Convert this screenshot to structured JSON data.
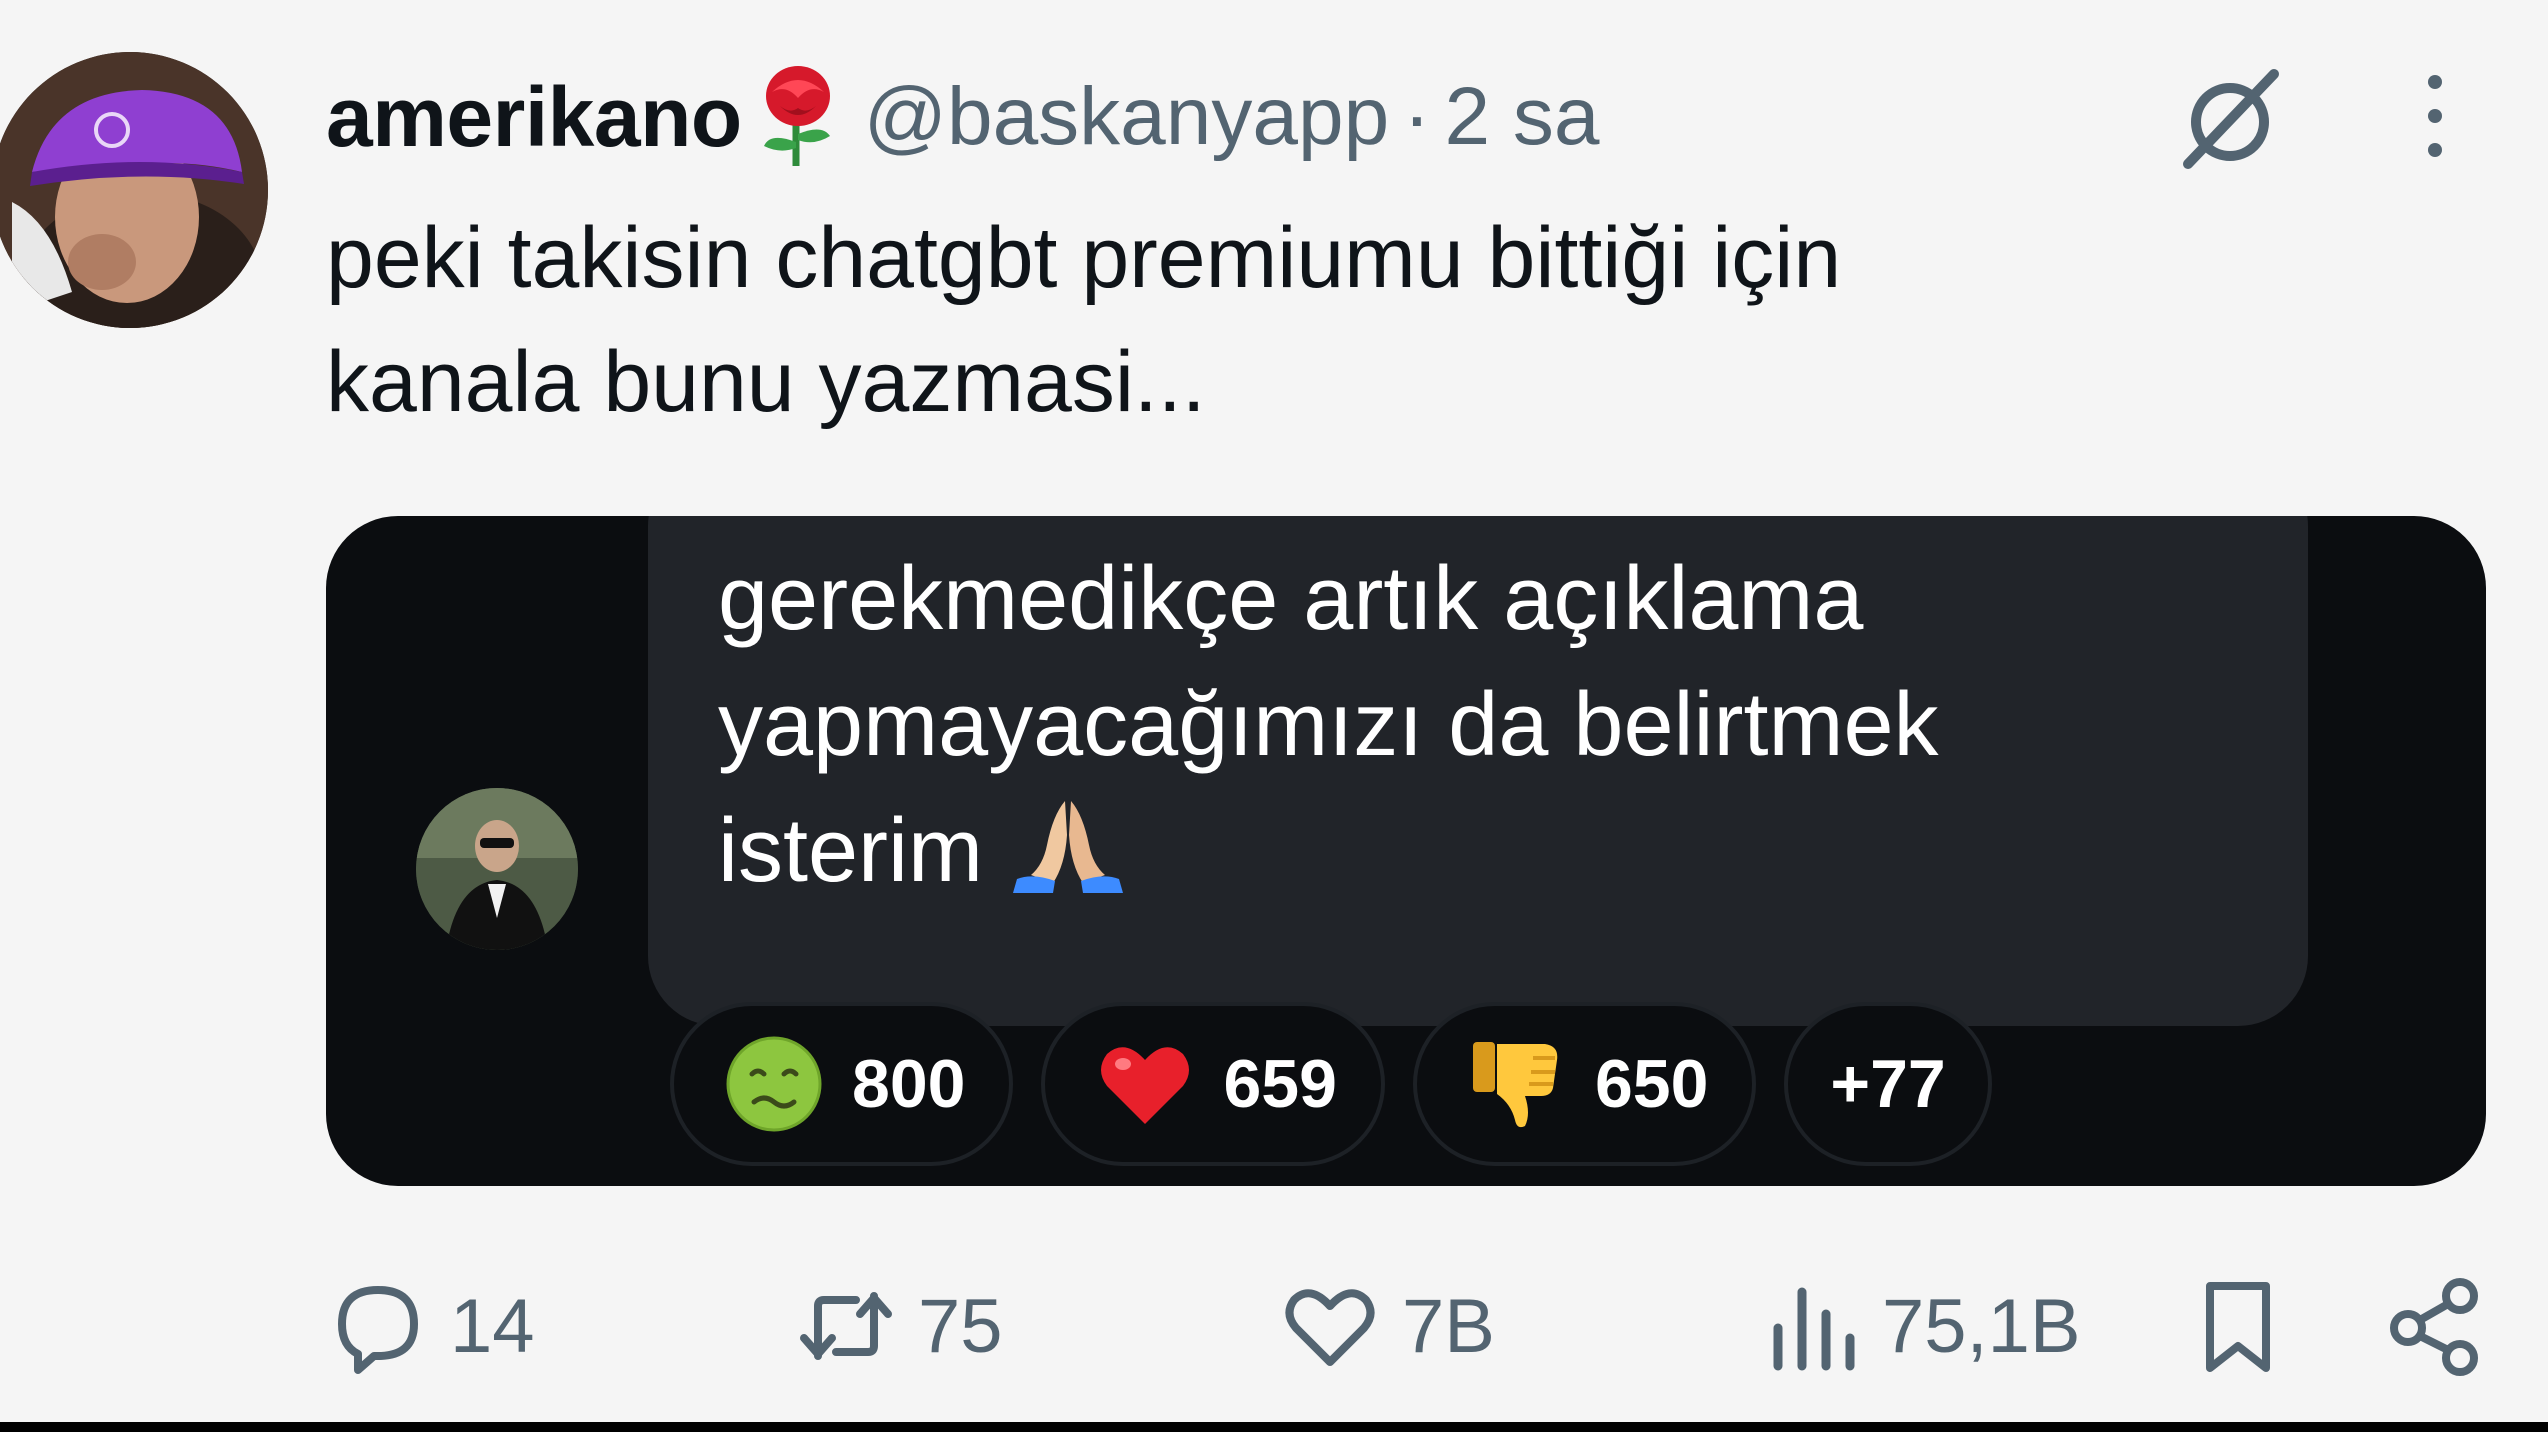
{
  "tweet": {
    "display_name": "amerikano",
    "handle": "@baskanyapp",
    "separator": "·",
    "time": "2 sa",
    "text_line1": "peki takisin chatgbt premiumu bittiği için",
    "text_line2": "kanala bunu yazmasi..."
  },
  "media": {
    "message_line1": "gerekmedikçe artık açıklama",
    "message_line2": "yapmayacağımızı da belirtmek",
    "message_line3": "isterim",
    "reactions": [
      {
        "icon": "nauseated-face-icon",
        "count": "800"
      },
      {
        "icon": "red-heart-icon",
        "count": "659"
      },
      {
        "icon": "thumbs-down-icon",
        "count": "650"
      },
      {
        "icon": "",
        "count": "+77"
      }
    ]
  },
  "actions": {
    "replies": "14",
    "reposts": "75",
    "likes": "7B",
    "views": "75,1B"
  },
  "colors": {
    "text": "#0f1419",
    "muted": "#536471",
    "card_bg": "#0b0d10",
    "bubble_bg": "#212429"
  }
}
